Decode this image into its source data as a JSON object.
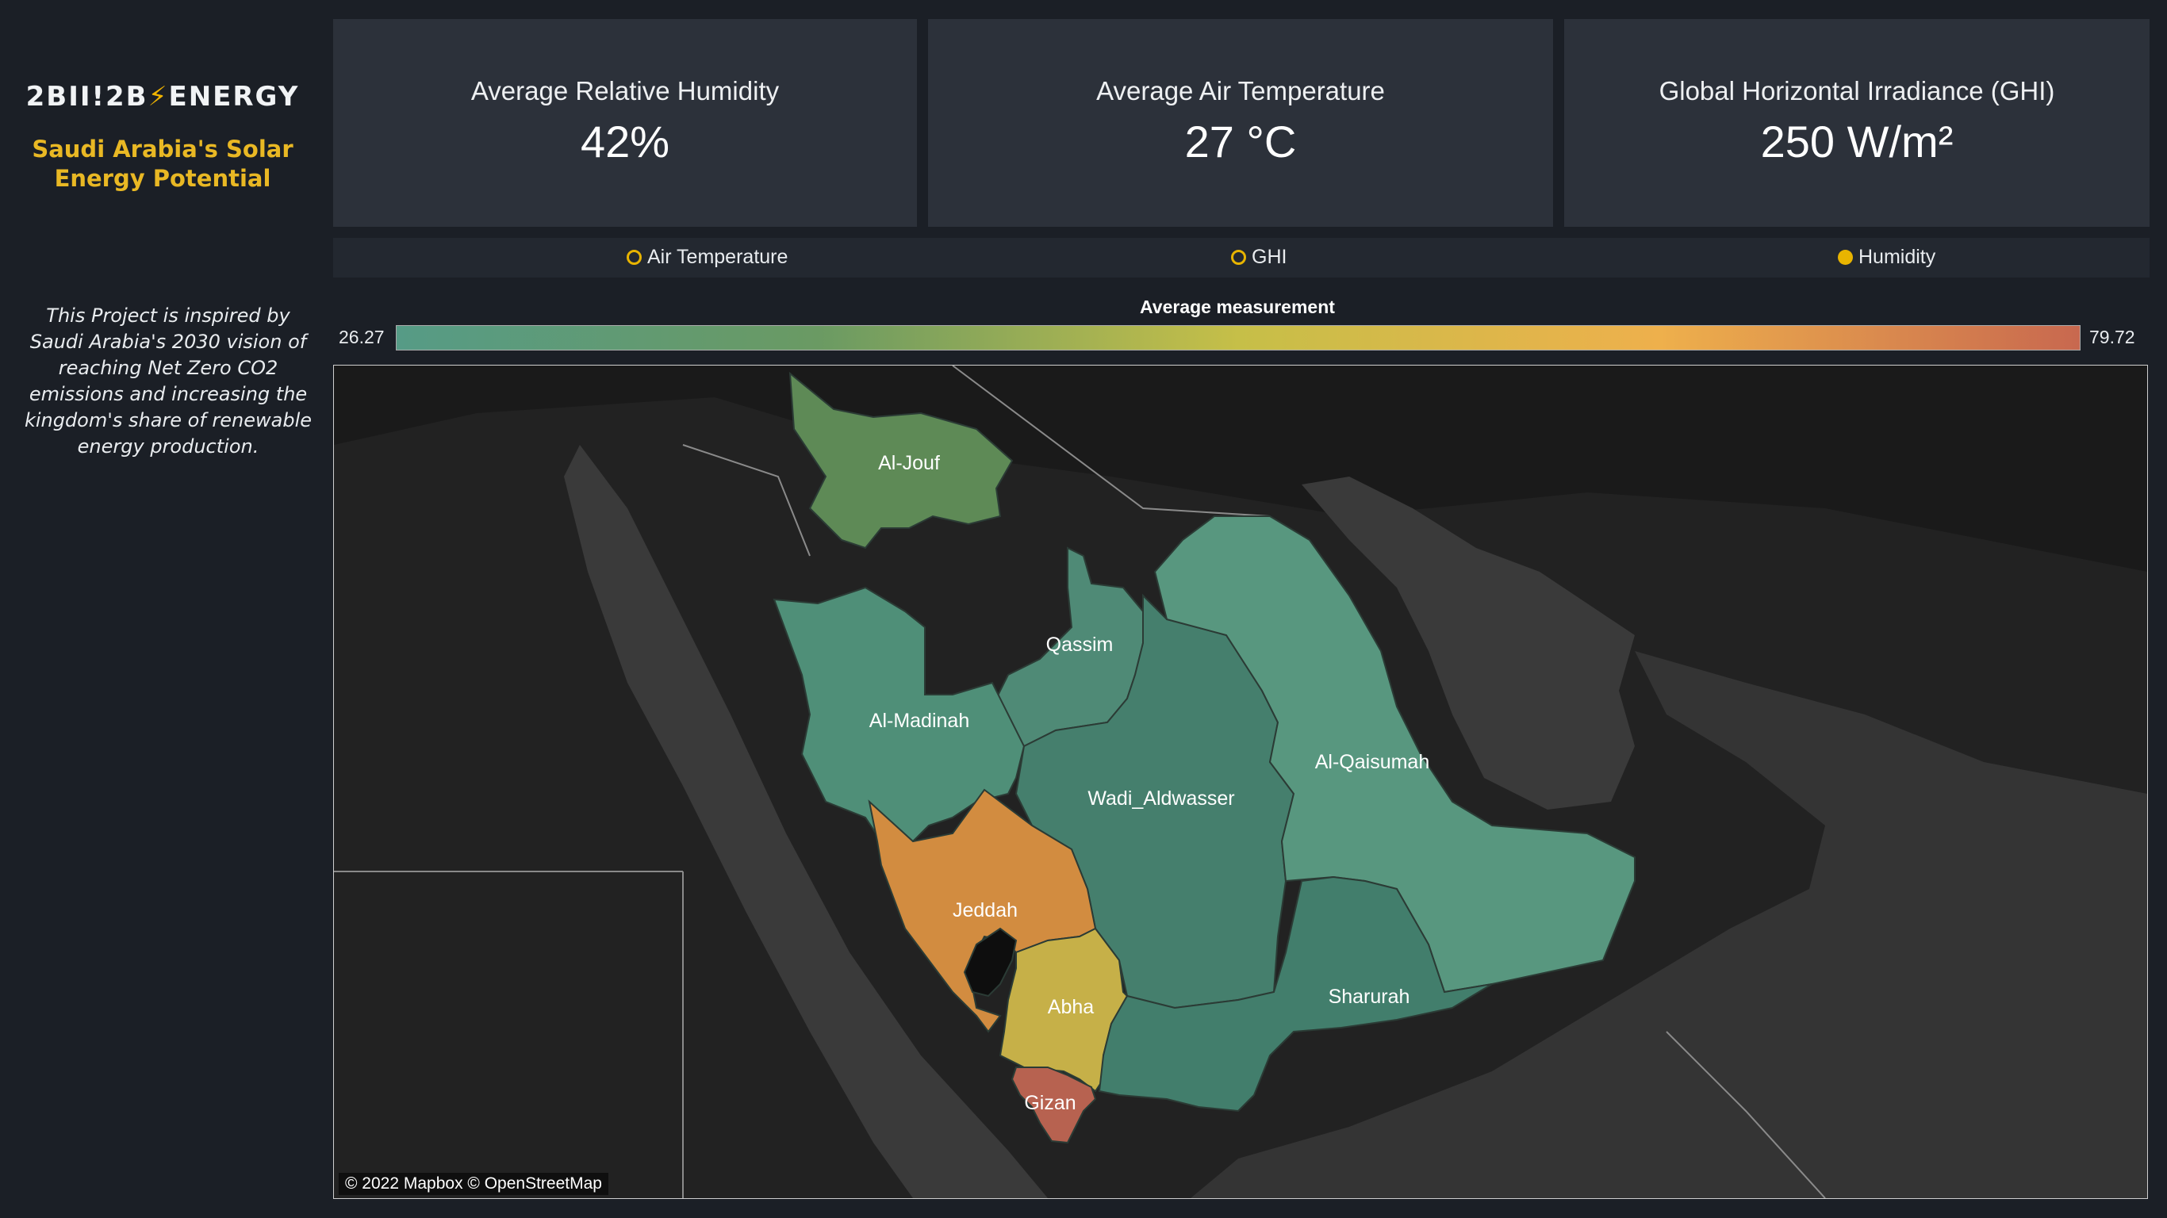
{
  "brand": {
    "logo_left": "2BII!2B",
    "logo_bolt": "⚡",
    "logo_right": "ENERGY",
    "subtitle_line1": "Saudi Arabia's Solar",
    "subtitle_line2": "Energy Potential"
  },
  "blurb": "This Project is inspired by Saudi Arabia's 2030 vision of reaching Net Zero CO2 emissions and increasing the kingdom's share of renewable energy production.",
  "kpis": [
    {
      "label": "Average Relative Humidity",
      "value": "42%"
    },
    {
      "label": "Average Air Temperature",
      "value": "27 °C"
    },
    {
      "label": "Global Horizontal Irradiance (GHI)",
      "value": "250 W/m²"
    }
  ],
  "measure_selector": {
    "options": [
      {
        "label": "Air Temperature",
        "selected": false
      },
      {
        "label": "GHI",
        "selected": false
      },
      {
        "label": "Humidity",
        "selected": true
      }
    ]
  },
  "color_legend": {
    "title": "Average measurement",
    "min": "26.27",
    "max": "79.72",
    "colors": [
      "#569b86",
      "#6a9a63",
      "#c6bf48",
      "#eeb04c",
      "#c8684f"
    ]
  },
  "map": {
    "credit": "© 2022 Mapbox © OpenStreetMap",
    "regions": [
      {
        "name": "Al-Jouf",
        "color": "#5e8a56"
      },
      {
        "name": "Qassim",
        "color": "#4f8a76"
      },
      {
        "name": "Al-Madinah",
        "color": "#4f8f78"
      },
      {
        "name": "Wadi_Aldwasser",
        "color": "#457f6d"
      },
      {
        "name": "Al-Qaisumah",
        "color": "#58977f"
      },
      {
        "name": "Jeddah",
        "color": "#d28c40"
      },
      {
        "name": "Abha",
        "color": "#c6b048"
      },
      {
        "name": "Sharurah",
        "color": "#427e6c"
      },
      {
        "name": "Gizan",
        "color": "#b76250"
      }
    ]
  }
}
